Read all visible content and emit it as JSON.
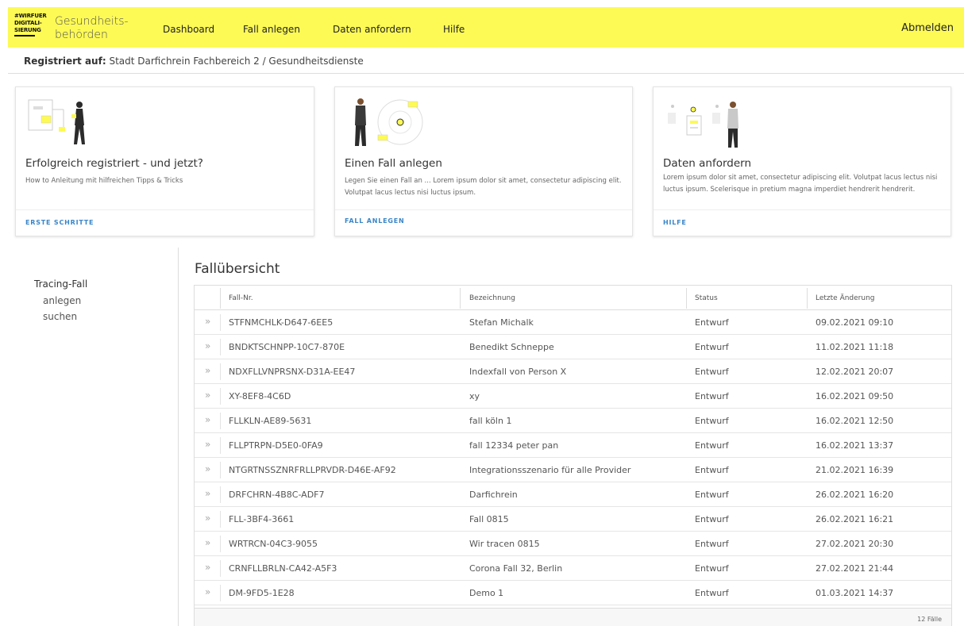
{
  "header": {
    "logo_lines": [
      "#WIRFUER",
      "DIGITALI-",
      "SIERUNG"
    ],
    "title_line1": "Gesundheits-",
    "title_line2": "behörden",
    "nav": [
      "Dashboard",
      "Fall anlegen",
      "Daten anfordern",
      "Hilfe"
    ],
    "logout": "Abmelden",
    "colors": {
      "bar": "#fdfa55",
      "accent": "#3a86c8"
    }
  },
  "registration": {
    "label": "Registriert auf:",
    "value": "Stadt Darfichrein Fachbereich 2 / Gesundheitsdienste"
  },
  "cards": [
    {
      "title": "Erfolgreich registriert - und jetzt?",
      "text": "How to Anleitung mit hilfreichen Tipps & Tricks",
      "link": "ERSTE SCHRITTE",
      "illustration": "onboarding-illustration"
    },
    {
      "title": "Einen Fall anlegen",
      "text": "Legen Sie einen Fall an ... Lorem ipsum dolor sit amet, consectetur adipiscing elit. Volutpat lacus lectus nisi luctus ipsum.",
      "link": "FALL ANLEGEN",
      "illustration": "create-case-illustration"
    },
    {
      "title": "Daten anfordern",
      "text": "Lorem ipsum dolor sit amet, consectetur adipiscing elit. Volutpat lacus lectus nisi luctus ipsum. Scelerisque in pretium magna imperdiet hendrerit hendrerit.",
      "link": "HILFE",
      "illustration": "request-data-illustration"
    }
  ],
  "sidebar": {
    "heading": "Tracing-Fall",
    "items": [
      "anlegen",
      "suchen"
    ]
  },
  "overview": {
    "title": "Fallübersicht",
    "columns": [
      "Fall-Nr.",
      "Bezeichnung",
      "Status",
      "Letzte Änderung"
    ],
    "row_icon": "chevron-double-right-icon",
    "rows": [
      [
        "STFNMCHLK-D647-6EE5",
        "Stefan Michalk",
        "Entwurf",
        "09.02.2021 09:10"
      ],
      [
        "BNDKTSCHNPP-10C7-870E",
        "Benedikt Schneppe",
        "Entwurf",
        "11.02.2021 11:18"
      ],
      [
        "NDXFLLVNPRSNX-D31A-EE47",
        "Indexfall von Person X",
        "Entwurf",
        "12.02.2021 20:07"
      ],
      [
        "XY-8EF8-4C6D",
        "xy",
        "Entwurf",
        "16.02.2021 09:50"
      ],
      [
        "FLLKLN-AE89-5631",
        "fall köln 1",
        "Entwurf",
        "16.02.2021 12:50"
      ],
      [
        "FLLPTRPN-D5E0-0FA9",
        "fall 12334 peter pan",
        "Entwurf",
        "16.02.2021 13:37"
      ],
      [
        "NTGRTNSSZNRFRLLPRVDR-D46E-AF92",
        "Integrationsszenario für alle Provider",
        "Entwurf",
        "21.02.2021 16:39"
      ],
      [
        "DRFCHRN-4B8C-ADF7",
        "Darfichrein",
        "Entwurf",
        "26.02.2021 16:20"
      ],
      [
        "FLL-3BF4-3661",
        "Fall 0815",
        "Entwurf",
        "26.02.2021 16:21"
      ],
      [
        "WRTRCN-04C3-9055",
        "Wir tracen 0815",
        "Entwurf",
        "27.02.2021 20:30"
      ],
      [
        "CRNFLLBRLN-CA42-A5F3",
        "Corona Fall 32, Berlin",
        "Entwurf",
        "27.02.2021 21:44"
      ],
      [
        "DM-9FD5-1E28",
        "Demo 1",
        "Entwurf",
        "01.03.2021 14:37"
      ]
    ],
    "count_label": "12 Fälle"
  }
}
